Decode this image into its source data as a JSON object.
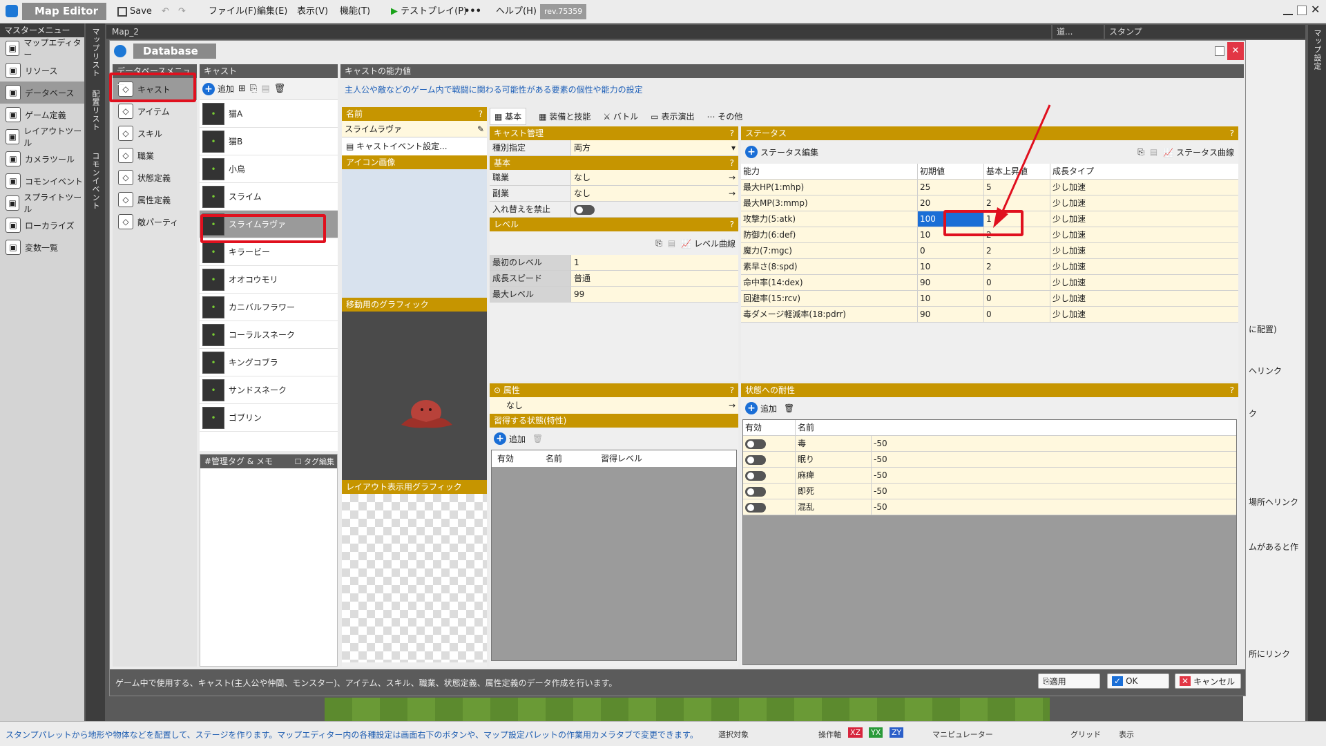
{
  "app": {
    "title": "Map Editor",
    "save": "Save",
    "menus": [
      "ファイル(F)",
      "編集(E)",
      "表示(V)",
      "機能(T)"
    ],
    "testplay": "テストプレイ(P)",
    "help": "ヘルプ(H)",
    "rev": "rev.75359"
  },
  "master_menu": {
    "title": "マスターメニュー",
    "items": [
      {
        "label": "マップエディター",
        "icon": "map-icon"
      },
      {
        "label": "リソース",
        "icon": "resource-icon"
      },
      {
        "label": "データベース",
        "icon": "database-icon",
        "selected": true
      },
      {
        "label": "ゲーム定義",
        "icon": "game-icon"
      },
      {
        "label": "レイアウトツール",
        "icon": "layout-icon"
      },
      {
        "label": "カメラツール",
        "icon": "camera-icon"
      },
      {
        "label": "コモンイベント",
        "icon": "event-icon"
      },
      {
        "label": "スプライトツール",
        "icon": "sprite-icon"
      },
      {
        "label": "ローカライズ",
        "icon": "globe-icon"
      },
      {
        "label": "変数一覧",
        "icon": "variable-icon"
      }
    ]
  },
  "vertical_tabs": [
    "マップリスト",
    "配置リスト",
    "コモンイベント"
  ],
  "map_tab": "Map_2",
  "right_tabs": [
    "道...",
    "スタンプ"
  ],
  "right_vtab": "マップ設定",
  "right_fragments": [
    "に配置)",
    "ヘリンク",
    "ク",
    "場所ヘリンク",
    "ムがあると作",
    "所にリンク"
  ],
  "db": {
    "title": "Database",
    "db_menu_title": "データベースメニュー",
    "db_menu": [
      "キャスト",
      "アイテム",
      "スキル",
      "職業",
      "状態定義",
      "属性定義",
      "敵パーティ"
    ],
    "cast_title": "キャスト",
    "toolbar_add": "追加",
    "cast_list": [
      "猫A",
      "猫B",
      "小鳥",
      "スライム",
      "スライムラヴァ",
      "キラービー",
      "オオコウモリ",
      "カニバルフラワー",
      "コーラルスネーク",
      "キングコブラ",
      "サンドスネーク",
      "ゴブリン"
    ],
    "cast_selected": "スライムラヴァ",
    "memo_title": "#管理タグ & メモ",
    "tag_edit": "タグ編集",
    "ability_title": "キャストの能力値",
    "description": "主人公や敵などのゲーム内で戦闘に関わる可能性がある要素の個性や能力の設定",
    "name_label": "名前",
    "name_value": "スライムラヴァ",
    "cast_event": "キャストイベント設定...",
    "icon_image": "アイコン画像",
    "move_graphic": "移動用のグラフィック",
    "layout_graphic": "レイアウト表示用グラフィック",
    "tabs": [
      "基本",
      "装備と技能",
      "バトル",
      "表示演出",
      "その他"
    ],
    "cast_mgmt": "キャスト管理",
    "kind_label": "種別指定",
    "kind_value": "両方",
    "basic": "基本",
    "job_label": "職業",
    "job_value": "なし",
    "subjob_label": "副業",
    "subjob_value": "なし",
    "swap_label": "入れ替えを禁止",
    "level": "レベル",
    "level_curve": "レベル曲線",
    "level_rows": [
      {
        "k": "最初のレベル",
        "v": "1"
      },
      {
        "k": "成長スピード",
        "v": "普通"
      },
      {
        "k": "最大レベル",
        "v": "99"
      }
    ],
    "attr": "属性",
    "attr_value": "なし",
    "learn": "習得する状態(特性)",
    "learn_cols": [
      "有効",
      "名前",
      "習得レベル"
    ],
    "status": "ステータス",
    "status_edit": "ステータス編集",
    "status_curve": "ステータス曲線",
    "status_cols": [
      "能力",
      "初期値",
      "基本上昇値",
      "成長タイプ"
    ],
    "status_rows": [
      {
        "name": "最大HP(1:mhp)",
        "init": "25",
        "inc": "5",
        "type": "少し加速"
      },
      {
        "name": "最大MP(3:mmp)",
        "init": "20",
        "inc": "2",
        "type": "少し加速"
      },
      {
        "name": "攻撃力(5:atk)",
        "init": "100",
        "inc": "1",
        "type": "少し加速"
      },
      {
        "name": "防御力(6:def)",
        "init": "10",
        "inc": "2",
        "type": "少し加速"
      },
      {
        "name": "魔力(7:mgc)",
        "init": "0",
        "inc": "2",
        "type": "少し加速"
      },
      {
        "name": "素早さ(8:spd)",
        "init": "10",
        "inc": "2",
        "type": "少し加速"
      },
      {
        "name": "命中率(14:dex)",
        "init": "90",
        "inc": "0",
        "type": "少し加速"
      },
      {
        "name": "回避率(15:rcv)",
        "init": "10",
        "inc": "0",
        "type": "少し加速"
      },
      {
        "name": "毒ダメージ軽減率(18:pdrr)",
        "init": "90",
        "inc": "0",
        "type": "少し加速"
      }
    ],
    "resist": "状態への耐性",
    "resist_cols": [
      "有効",
      "名前"
    ],
    "resist_rows": [
      {
        "name": "毒",
        "v": "-50"
      },
      {
        "name": "眠り",
        "v": "-50"
      },
      {
        "name": "麻痺",
        "v": "-50"
      },
      {
        "name": "即死",
        "v": "-50"
      },
      {
        "name": "混乱",
        "v": "-50"
      }
    ],
    "footer_text": "ゲーム中で使用する、キャスト(主人公や仲間、モンスター)、アイテム、スキル、職業、状態定義、属性定義のデータ作成を行います。",
    "apply": "適用",
    "ok": "OK",
    "cancel": "キャンセル"
  },
  "statusbar": {
    "text": "スタンプパレットから地形や物体などを配置して、ステージを作ります。マップエディター内の各種設定は画面右下のボタンや、マップ設定パレットの作業用カメラタブで変更できます。",
    "labels": [
      "選択対象",
      "操作軸",
      "マニピュレーター",
      "グリッド",
      "表示"
    ],
    "axes": [
      "XZ",
      "YX",
      "ZY"
    ]
  }
}
